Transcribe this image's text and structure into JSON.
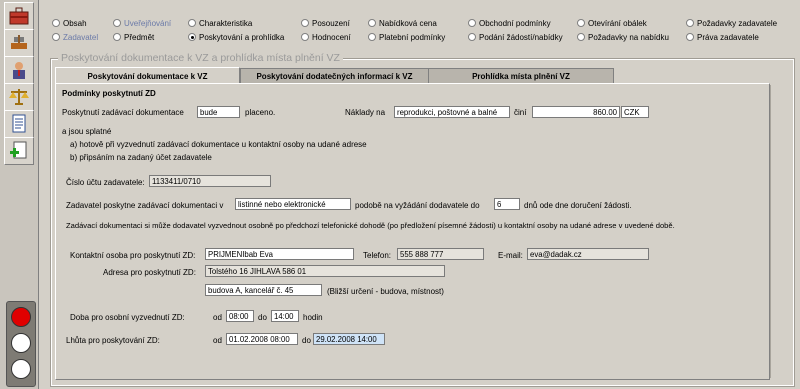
{
  "nav": {
    "row1": [
      {
        "label": "Obsah",
        "selected": false,
        "disabled": false
      },
      {
        "label": "Uveřejňování",
        "selected": false,
        "disabled": true
      },
      {
        "label": "Charakteristika",
        "selected": false,
        "disabled": false
      },
      {
        "label": "Posouzení",
        "selected": false,
        "disabled": false
      },
      {
        "label": "Nabídková cena",
        "selected": false,
        "disabled": false
      },
      {
        "label": "Obchodní podmínky",
        "selected": false,
        "disabled": false
      },
      {
        "label": "Otevírání obálek",
        "selected": false,
        "disabled": false
      },
      {
        "label": "Požadavky zadavatele",
        "selected": false,
        "disabled": false
      }
    ],
    "row2": [
      {
        "label": "Zadavatel",
        "selected": false,
        "disabled": true
      },
      {
        "label": "Předmět",
        "selected": false,
        "disabled": false
      },
      {
        "label": "Poskytování a prohlídka",
        "selected": true,
        "disabled": false
      },
      {
        "label": "Hodnocení",
        "selected": false,
        "disabled": false
      },
      {
        "label": "Platební podmínky",
        "selected": false,
        "disabled": false
      },
      {
        "label": "Podání žádostí/nabídky",
        "selected": false,
        "disabled": false
      },
      {
        "label": "Požadavky na nabídku",
        "selected": false,
        "disabled": false
      },
      {
        "label": "Práva zadavatele",
        "selected": false,
        "disabled": false
      }
    ]
  },
  "group_title": "Poskytování dokumentace k VZ a prohlídka místa plnění VZ",
  "tabs": [
    {
      "label": "Poskytování dokumentace k VZ",
      "active": true
    },
    {
      "label": "Poskytování dodatečných informací k VZ",
      "active": false
    },
    {
      "label": "Prohlídka místa plnění VZ",
      "active": false
    }
  ],
  "form": {
    "section_heading": "Podmínky poskytnutí ZD",
    "provide_label": "Poskytnutí zadávací dokumentace",
    "provide_value": "bude",
    "provide_suffix": "placeno.",
    "costs_label": "Náklady na",
    "costs_value": "reprodukci, poštovné a balné",
    "amount_label": "činí",
    "amount_value": "860.00",
    "currency_value": "CZK",
    "payable_label": "a jsou splatné",
    "payable_a": "a) hotově při vyzvednutí zadávací dokumentace u kontaktní osoby na udané adrese",
    "payable_b": "b) připsáním na zadaný účet zadavatele",
    "account_label": "Číslo účtu zadavatele:",
    "account_value": "1133411/0710",
    "provides_prefix": "Zadavatel poskytne zadávací dokumentaci v",
    "provides_value": "listinné nebo elektronické",
    "provides_mid": "podobě na vyžádání dodavatele do",
    "days_value": "6",
    "provides_suffix": "dnů ode dne doručení žádosti.",
    "pickup_note": "Zadávací dokumentaci si může dodavatel vyzvednout osobně po předchozí telefonické dohodě (po předložení písemné žádosti) u kontaktní osoby na udané adrese v uvedené době.",
    "contact_label": "Kontaktní osoba pro poskytnutí ZD:",
    "contact_value": "PRIJMENIbab Eva",
    "phone_label": "Telefon:",
    "phone_value": "555 888 777",
    "email_label": "E-mail:",
    "email_value": "eva@dadak.cz",
    "address_label": "Adresa pro poskytnutí ZD:",
    "address_value": "Tolstého 16 JIHLAVA 586 01",
    "address2_value": "budova A, kancelář č. 45",
    "address2_hint": "(Bližší určení - budova, místnost)",
    "pickup_time_label": "Doba pro osobní vyzvednutí ZD:",
    "from_label": "od",
    "from_time": "08:00",
    "to_label": "do",
    "to_time": "14:00",
    "hours_label": "hodin",
    "deadline_label": "Lhůta pro poskytování ZD:",
    "deadline_from_label": "od",
    "deadline_from": "01.02.2008 08:00",
    "deadline_to_label": "do",
    "deadline_to": "29.02.2008 14:00"
  }
}
